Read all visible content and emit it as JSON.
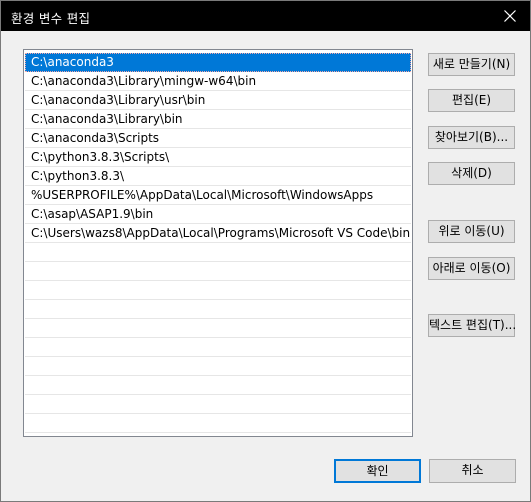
{
  "window": {
    "title": "환경 변수 편집",
    "close_label": "✕"
  },
  "list": {
    "items": [
      {
        "text": "C:\\anaconda3",
        "selected": true
      },
      {
        "text": "C:\\anaconda3\\Library\\mingw-w64\\bin"
      },
      {
        "text": "C:\\anaconda3\\Library\\usr\\bin"
      },
      {
        "text": "C:\\anaconda3\\Library\\bin"
      },
      {
        "text": "C:\\anaconda3\\Scripts"
      },
      {
        "text": "C:\\python3.8.3\\Scripts\\"
      },
      {
        "text": "C:\\python3.8.3\\"
      },
      {
        "text": "%USERPROFILE%\\AppData\\Local\\Microsoft\\WindowsApps"
      },
      {
        "text": "C:\\asap\\ASAP1.9\\bin"
      },
      {
        "text": "C:\\Users\\wazs8\\AppData\\Local\\Programs\\Microsoft VS Code\\bin"
      },
      {
        "text": ""
      },
      {
        "text": ""
      },
      {
        "text": ""
      },
      {
        "text": ""
      },
      {
        "text": ""
      },
      {
        "text": ""
      },
      {
        "text": ""
      },
      {
        "text": ""
      },
      {
        "text": ""
      },
      {
        "text": ""
      }
    ]
  },
  "buttons": {
    "new": "새로 만들기(N)",
    "edit": "편집(E)",
    "browse": "찾아보기(B)...",
    "delete": "삭제(D)",
    "move_up": "위로 이동(U)",
    "move_down": "아래로 이동(O)",
    "edit_text": "텍스트 편집(T)...",
    "ok": "확인",
    "cancel": "취소"
  },
  "colors": {
    "selection": "#0078d7",
    "titlebar": "#000000",
    "dialog_bg": "#f0f0f0"
  }
}
